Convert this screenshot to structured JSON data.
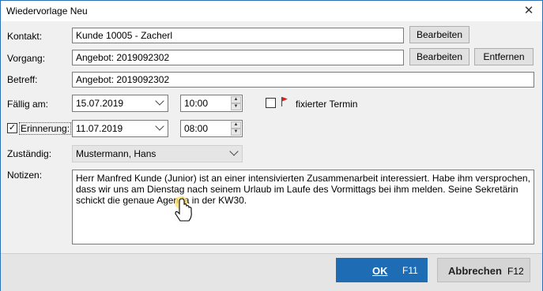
{
  "window": {
    "title": "Wiedervorlage Neu"
  },
  "fields": {
    "kontakt": {
      "label": "Kontakt:",
      "value": "Kunde 10005 - Zacherl",
      "edit_label": "Bearbeiten"
    },
    "vorgang": {
      "label": "Vorgang:",
      "value": "Angebot: 2019092302",
      "edit_label": "Bearbeiten",
      "remove_label": "Entfernen"
    },
    "betreff": {
      "label": "Betreff:",
      "value": "Angebot: 2019092302"
    },
    "faellig": {
      "label": "Fällig am:",
      "date": "15.07.2019",
      "time": "10:00",
      "fixed_label": "fixierter Termin",
      "fixed_checked": false
    },
    "erinnerung": {
      "label": "Erinnerung:",
      "checked": true,
      "date": "11.07.2019",
      "time": "08:00"
    },
    "zustaendig": {
      "label": "Zuständig:",
      "value": "Mustermann, Hans"
    },
    "notizen": {
      "label": "Notizen:",
      "text": "Herr Manfred Kunde (Junior) ist an einer intensivierten Zusammenarbeit interessiert. Habe ihm versprochen, dass wir uns am Dienstag nach seinem Urlaub im Laufe des Vormittags bei ihm melden. Seine Sekretärin schickt die genaue Agenda in der KW30."
    }
  },
  "footer": {
    "ok_label": "OK",
    "ok_shortcut": "F11",
    "cancel_label": "Abbrechen",
    "cancel_shortcut": "F12"
  },
  "colors": {
    "accent": "#1e6cb4",
    "flag": "#e21a1a"
  }
}
